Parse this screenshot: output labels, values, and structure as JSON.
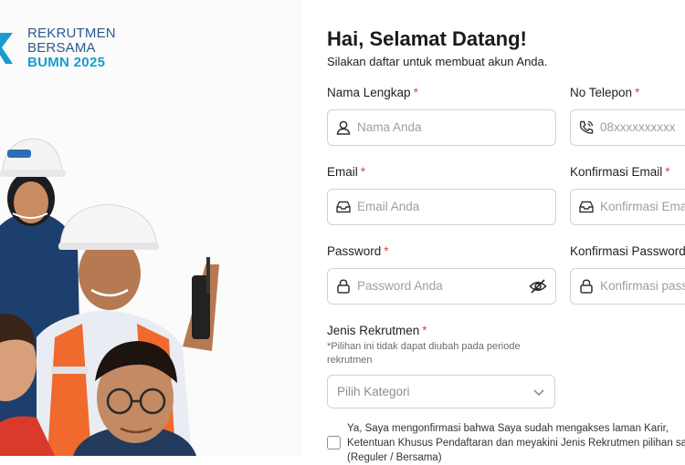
{
  "brand": {
    "line1": "REKRUTMEN",
    "line2": "BERSAMA",
    "line3": "BUMN 2025"
  },
  "colors": {
    "brand_blue": "#2b5a8a",
    "brand_cyan": "#1b9bd0",
    "required": "#e0453d",
    "border": "#cdd3da"
  },
  "form": {
    "title": "Hai, Selamat Datang!",
    "subtitle": "Silakan daftar untuk membuat akun Anda.",
    "fields": {
      "full_name": {
        "label": "Nama Lengkap",
        "placeholder": "Nama Anda",
        "icon": "user-icon"
      },
      "phone": {
        "label": "No Telepon",
        "placeholder": "08xxxxxxxxxx",
        "icon": "phone-icon"
      },
      "email": {
        "label": "Email",
        "placeholder": "Email Anda",
        "icon": "inbox-icon"
      },
      "confirm_email": {
        "label": "Konfirmasi Email",
        "placeholder": "Konfirmasi Email",
        "icon": "inbox-icon"
      },
      "password": {
        "label": "Password",
        "placeholder": "Password Anda",
        "icon": "lock-icon",
        "toggle_icon": "eye-off-icon"
      },
      "confirm_password": {
        "label": "Konfirmasi Password",
        "placeholder": "Konfirmasi password",
        "icon": "lock-icon"
      }
    },
    "required_mark": "*",
    "recruitment_type": {
      "label": "Jenis Rekrutmen",
      "note": "*Pilihan ini tidak dapat diubah pada periode rekrutmen",
      "selected": "Pilih Kategori"
    },
    "consent_text": "Ya, Saya mengonfirmasi bahwa Saya sudah mengakses laman Karir, Ketentuan Khusus Pendaftaran dan meyakini Jenis Rekrutmen pilihan saya (Reguler / Bersama)"
  }
}
